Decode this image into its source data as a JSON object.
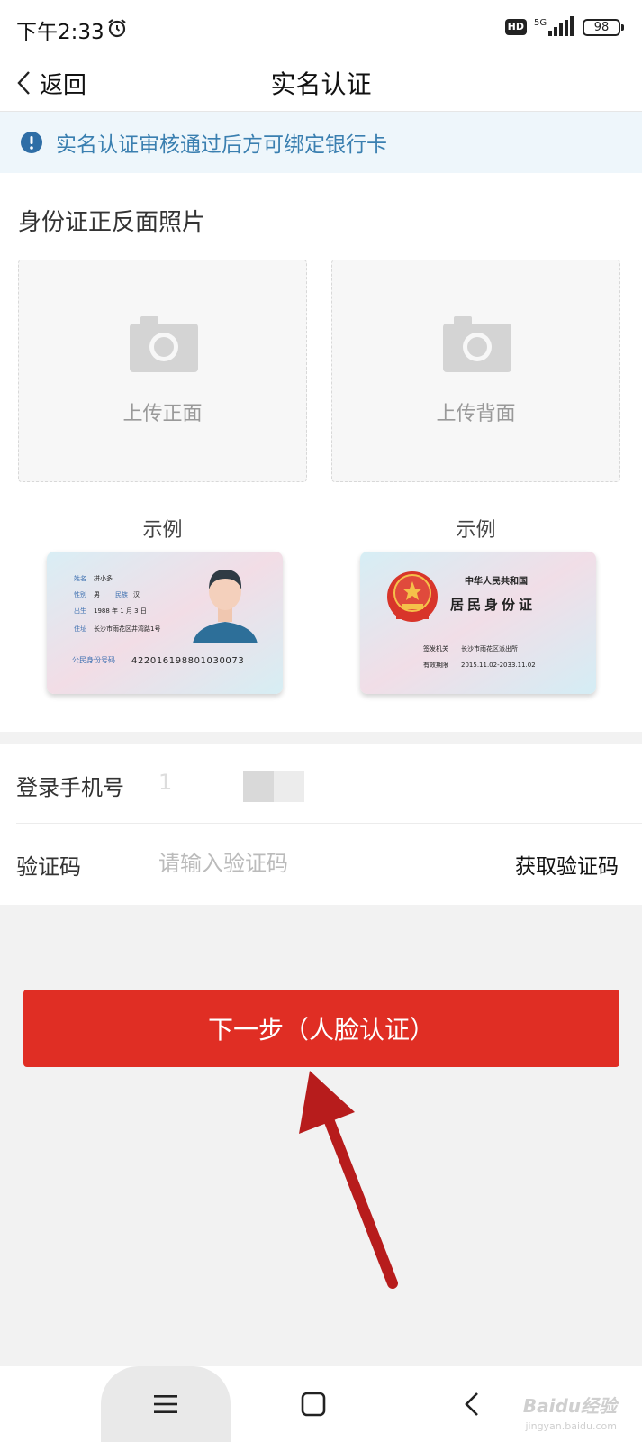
{
  "status_bar": {
    "time": "下午2:33",
    "network": "5G",
    "hd": "HD",
    "battery": "98"
  },
  "nav": {
    "back_label": "返回",
    "title": "实名认证"
  },
  "notice": {
    "text": "实名认证审核通过后方可绑定银行卡"
  },
  "id_section": {
    "title": "身份证正反面照片",
    "upload_front_label": "上传正面",
    "upload_back_label": "上传背面",
    "example_label": "示例",
    "front_card": {
      "name_label": "姓名",
      "name": "拼小多",
      "gender_label": "性别",
      "gender": "男",
      "ethnicity_label": "民族",
      "ethnicity": "汉",
      "birth_label": "出生",
      "birth": "1988 年 1 月 3 日",
      "address_label": "住址",
      "address": "长沙市雨花区井湾路1号",
      "id_label": "公民身份号码",
      "id_number": "422016198801030073"
    },
    "back_card": {
      "country": "中华人民共和国",
      "title": "居民身份证",
      "authority_label": "签发机关",
      "authority": "长沙市雨花区派出所",
      "validity_label": "有效期限",
      "validity": "2015.11.02-2033.11.02"
    }
  },
  "form": {
    "phone_label": "登录手机号",
    "phone_value": "1",
    "code_label": "验证码",
    "code_placeholder": "请输入验证码",
    "code_value": "",
    "get_code_label": "获取验证码"
  },
  "next_button": {
    "label": "下一步（人脸认证）"
  },
  "watermark": {
    "brand": "Baidu经验",
    "url": "jingyan.baidu.com"
  },
  "colors": {
    "primary_red": "#e02e24",
    "notice_blue": "#3a7fb0",
    "notice_bg": "#eef6fb",
    "annotation_arrow": "#b71c1c"
  }
}
